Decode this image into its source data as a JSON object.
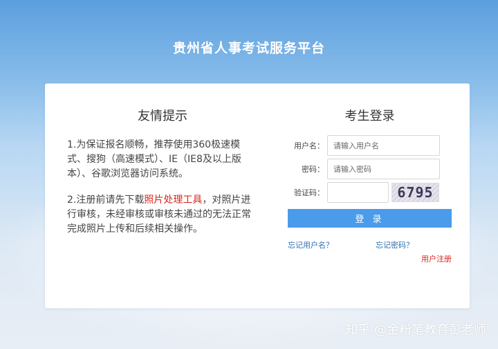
{
  "header": {
    "title": "贵州省人事考试服务平台"
  },
  "tips": {
    "title": "友情提示",
    "item1": "1.为保证报名顺畅，推荐使用360极速模式、搜狗（高速模式）、IE（IE8及以上版本）、谷歌浏览器访问系统。",
    "item2_pre": "2.注册前请先下载",
    "item2_link": "照片处理工具",
    "item2_post": "，对照片进行审核，未经审核或审核未通过的无法正常完成照片上传和后续相关操作。"
  },
  "login": {
    "title": "考生登录",
    "username_label": "用户名：",
    "username_placeholder": "请输入用户名",
    "password_label": "密码：",
    "password_placeholder": "请输入密码",
    "captcha_label": "验证码：",
    "captcha_value": "",
    "captcha_text": "6795",
    "submit_label": "登 录",
    "forgot_username": "忘记用户名？",
    "forgot_password": "忘记密码？",
    "register": "用户注册"
  },
  "watermark": "知乎 @金粉笔教育彭老师",
  "colors": {
    "accent": "#4a9bea",
    "link": "#2d6fb3",
    "highlight": "#d9261c"
  }
}
